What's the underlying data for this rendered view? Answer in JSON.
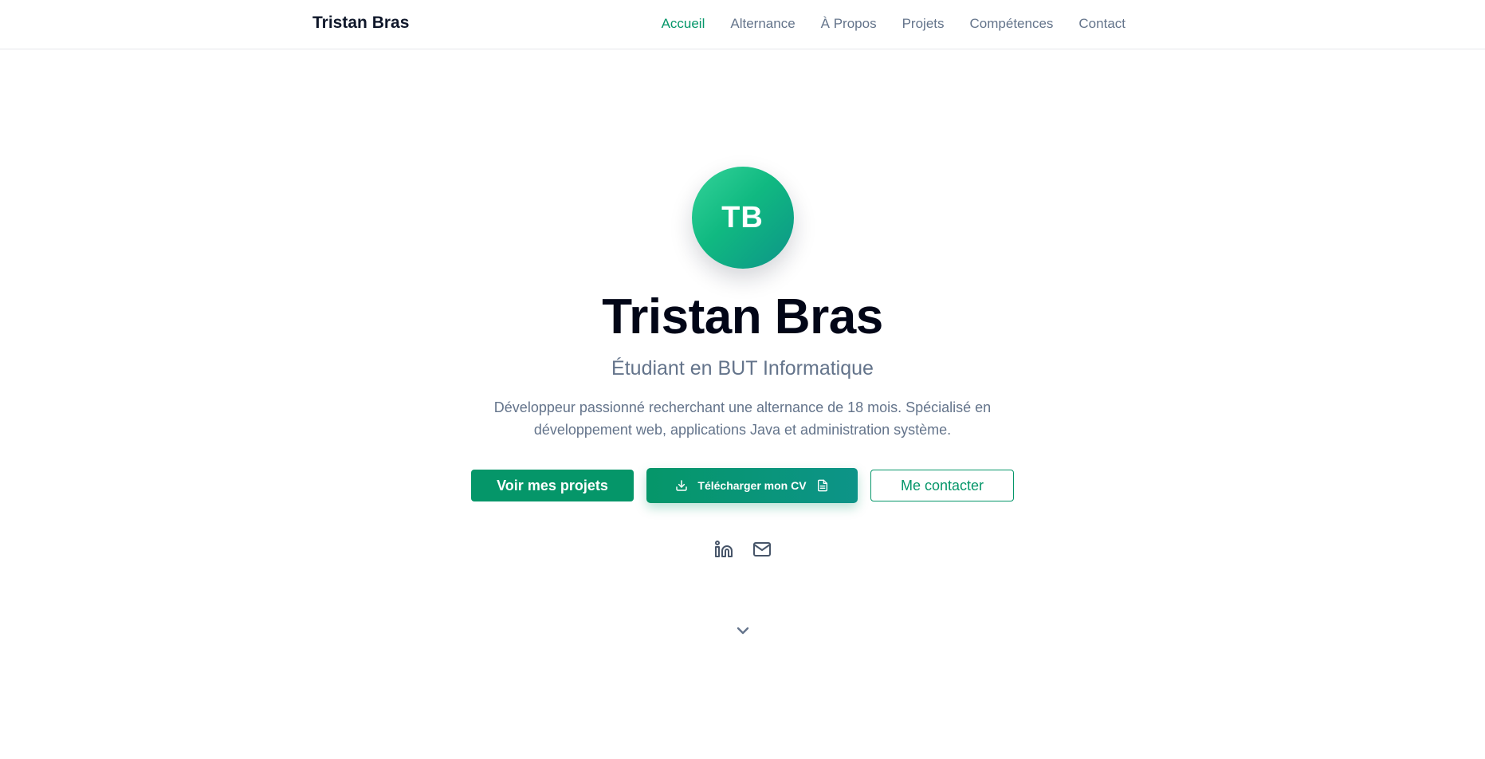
{
  "navbar": {
    "brand": "Tristan Bras",
    "links": [
      {
        "label": "Accueil",
        "active": true
      },
      {
        "label": "Alternance",
        "active": false
      },
      {
        "label": "À Propos",
        "active": false
      },
      {
        "label": "Projets",
        "active": false
      },
      {
        "label": "Compétences",
        "active": false
      },
      {
        "label": "Contact",
        "active": false
      }
    ]
  },
  "hero": {
    "avatar_initials": "TB",
    "name": "Tristan Bras",
    "subtitle": "Étudiant en BUT Informatique",
    "description": "Développeur passionné recherchant une alternance de 18 mois. Spécialisé en développement web, applications Java et administration système.",
    "buttons": {
      "projects": "Voir mes projets",
      "cv": "Télécharger mon CV",
      "contact": "Me contacter"
    },
    "socials": [
      {
        "icon": "linkedin-icon"
      },
      {
        "icon": "mail-icon"
      }
    ],
    "scroll_icon": "chevron-down-icon"
  },
  "colors": {
    "accent": "#059669",
    "accent_teal": "#0d9488",
    "text_muted": "#64748b",
    "heading": "#020617"
  }
}
